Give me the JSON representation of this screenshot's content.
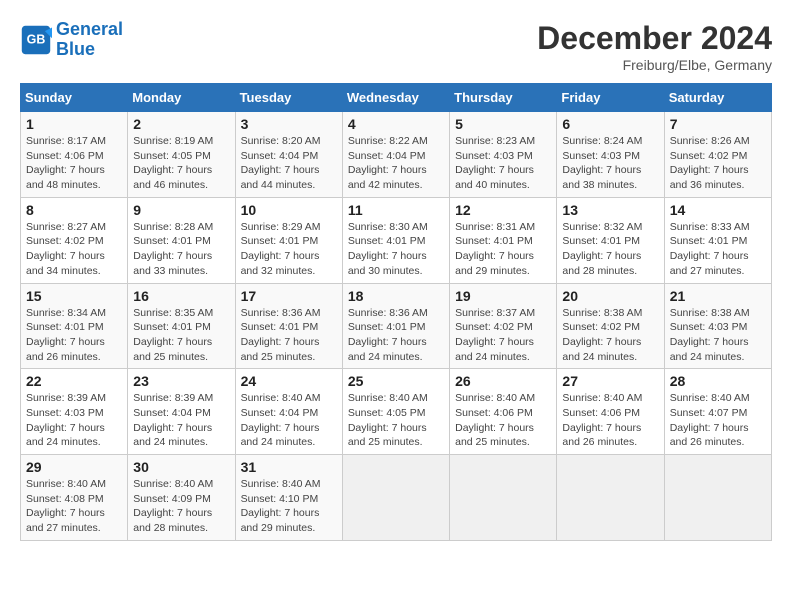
{
  "header": {
    "logo_line1": "General",
    "logo_line2": "Blue",
    "title": "December 2024",
    "subtitle": "Freiburg/Elbe, Germany"
  },
  "calendar": {
    "days_of_week": [
      "Sunday",
      "Monday",
      "Tuesday",
      "Wednesday",
      "Thursday",
      "Friday",
      "Saturday"
    ],
    "weeks": [
      [
        {
          "day": "1",
          "info": "Sunrise: 8:17 AM\nSunset: 4:06 PM\nDaylight: 7 hours and 48 minutes."
        },
        {
          "day": "2",
          "info": "Sunrise: 8:19 AM\nSunset: 4:05 PM\nDaylight: 7 hours and 46 minutes."
        },
        {
          "day": "3",
          "info": "Sunrise: 8:20 AM\nSunset: 4:04 PM\nDaylight: 7 hours and 44 minutes."
        },
        {
          "day": "4",
          "info": "Sunrise: 8:22 AM\nSunset: 4:04 PM\nDaylight: 7 hours and 42 minutes."
        },
        {
          "day": "5",
          "info": "Sunrise: 8:23 AM\nSunset: 4:03 PM\nDaylight: 7 hours and 40 minutes."
        },
        {
          "day": "6",
          "info": "Sunrise: 8:24 AM\nSunset: 4:03 PM\nDaylight: 7 hours and 38 minutes."
        },
        {
          "day": "7",
          "info": "Sunrise: 8:26 AM\nSunset: 4:02 PM\nDaylight: 7 hours and 36 minutes."
        }
      ],
      [
        {
          "day": "8",
          "info": "Sunrise: 8:27 AM\nSunset: 4:02 PM\nDaylight: 7 hours and 34 minutes."
        },
        {
          "day": "9",
          "info": "Sunrise: 8:28 AM\nSunset: 4:01 PM\nDaylight: 7 hours and 33 minutes."
        },
        {
          "day": "10",
          "info": "Sunrise: 8:29 AM\nSunset: 4:01 PM\nDaylight: 7 hours and 32 minutes."
        },
        {
          "day": "11",
          "info": "Sunrise: 8:30 AM\nSunset: 4:01 PM\nDaylight: 7 hours and 30 minutes."
        },
        {
          "day": "12",
          "info": "Sunrise: 8:31 AM\nSunset: 4:01 PM\nDaylight: 7 hours and 29 minutes."
        },
        {
          "day": "13",
          "info": "Sunrise: 8:32 AM\nSunset: 4:01 PM\nDaylight: 7 hours and 28 minutes."
        },
        {
          "day": "14",
          "info": "Sunrise: 8:33 AM\nSunset: 4:01 PM\nDaylight: 7 hours and 27 minutes."
        }
      ],
      [
        {
          "day": "15",
          "info": "Sunrise: 8:34 AM\nSunset: 4:01 PM\nDaylight: 7 hours and 26 minutes."
        },
        {
          "day": "16",
          "info": "Sunrise: 8:35 AM\nSunset: 4:01 PM\nDaylight: 7 hours and 25 minutes."
        },
        {
          "day": "17",
          "info": "Sunrise: 8:36 AM\nSunset: 4:01 PM\nDaylight: 7 hours and 25 minutes."
        },
        {
          "day": "18",
          "info": "Sunrise: 8:36 AM\nSunset: 4:01 PM\nDaylight: 7 hours and 24 minutes."
        },
        {
          "day": "19",
          "info": "Sunrise: 8:37 AM\nSunset: 4:02 PM\nDaylight: 7 hours and 24 minutes."
        },
        {
          "day": "20",
          "info": "Sunrise: 8:38 AM\nSunset: 4:02 PM\nDaylight: 7 hours and 24 minutes."
        },
        {
          "day": "21",
          "info": "Sunrise: 8:38 AM\nSunset: 4:03 PM\nDaylight: 7 hours and 24 minutes."
        }
      ],
      [
        {
          "day": "22",
          "info": "Sunrise: 8:39 AM\nSunset: 4:03 PM\nDaylight: 7 hours and 24 minutes."
        },
        {
          "day": "23",
          "info": "Sunrise: 8:39 AM\nSunset: 4:04 PM\nDaylight: 7 hours and 24 minutes."
        },
        {
          "day": "24",
          "info": "Sunrise: 8:40 AM\nSunset: 4:04 PM\nDaylight: 7 hours and 24 minutes."
        },
        {
          "day": "25",
          "info": "Sunrise: 8:40 AM\nSunset: 4:05 PM\nDaylight: 7 hours and 25 minutes."
        },
        {
          "day": "26",
          "info": "Sunrise: 8:40 AM\nSunset: 4:06 PM\nDaylight: 7 hours and 25 minutes."
        },
        {
          "day": "27",
          "info": "Sunrise: 8:40 AM\nSunset: 4:06 PM\nDaylight: 7 hours and 26 minutes."
        },
        {
          "day": "28",
          "info": "Sunrise: 8:40 AM\nSunset: 4:07 PM\nDaylight: 7 hours and 26 minutes."
        }
      ],
      [
        {
          "day": "29",
          "info": "Sunrise: 8:40 AM\nSunset: 4:08 PM\nDaylight: 7 hours and 27 minutes."
        },
        {
          "day": "30",
          "info": "Sunrise: 8:40 AM\nSunset: 4:09 PM\nDaylight: 7 hours and 28 minutes."
        },
        {
          "day": "31",
          "info": "Sunrise: 8:40 AM\nSunset: 4:10 PM\nDaylight: 7 hours and 29 minutes."
        },
        {
          "day": "",
          "info": ""
        },
        {
          "day": "",
          "info": ""
        },
        {
          "day": "",
          "info": ""
        },
        {
          "day": "",
          "info": ""
        }
      ]
    ]
  }
}
